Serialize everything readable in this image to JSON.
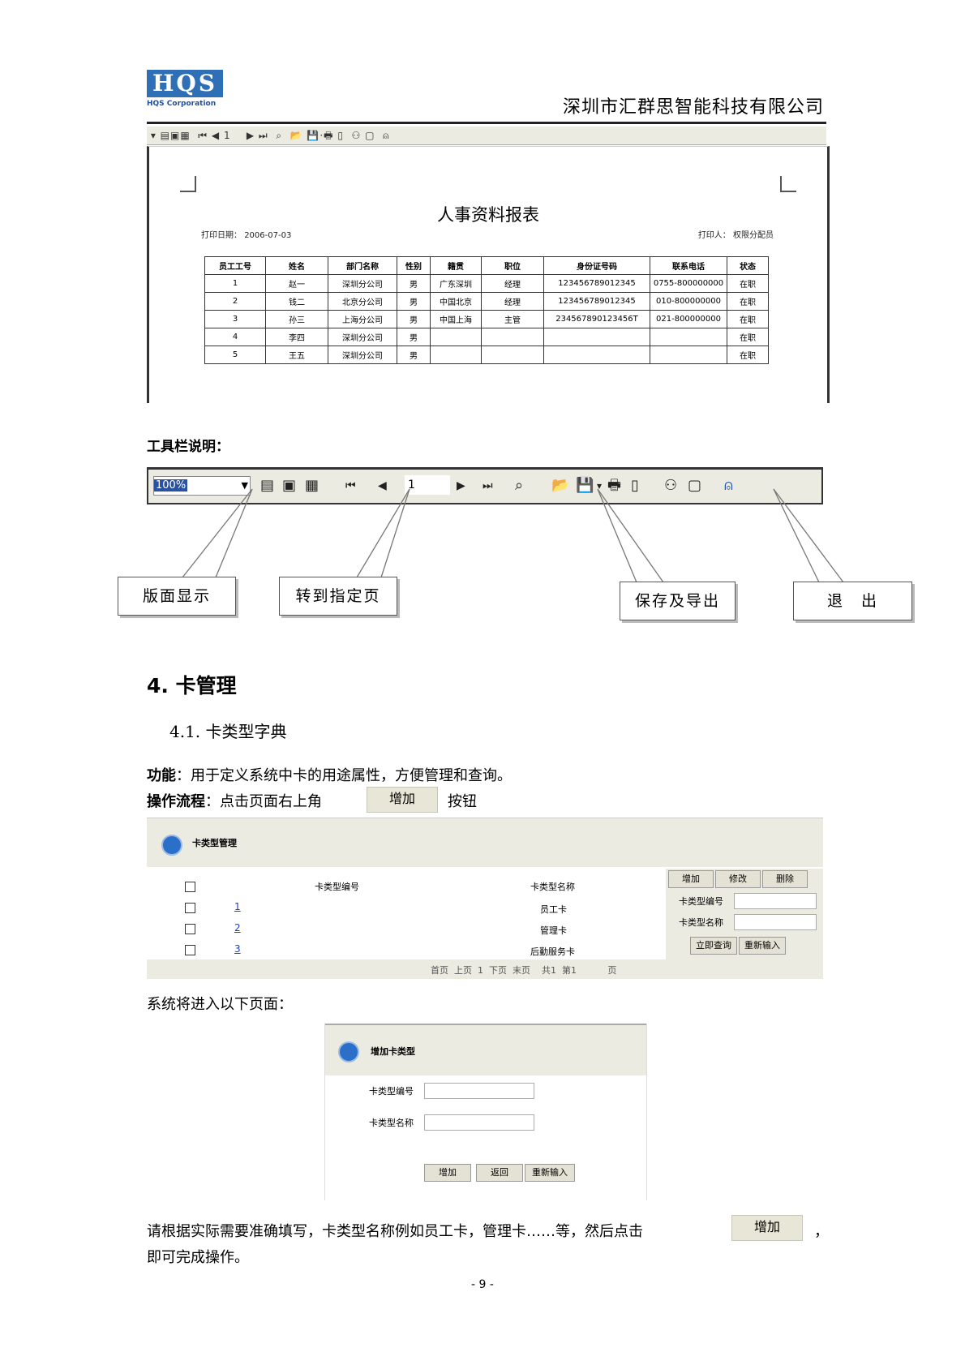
{
  "header": {
    "logo": "HQS",
    "logo_sub": "HQS Corporation",
    "company": "深圳市汇群思智能科技有限公司"
  },
  "toolbar_small": {
    "page": "1"
  },
  "report": {
    "title": "人事资料报表",
    "print_date_label": "打印日期：",
    "print_date": "2006-07-03",
    "printer_label": "打印人：",
    "printer": "权限分配员",
    "columns": [
      "员工工号",
      "姓名",
      "部门名称",
      "性别",
      "籍贯",
      "职位",
      "身份证号码",
      "联系电话",
      "状态"
    ],
    "rows": [
      [
        "1",
        "赵一",
        "深圳分公司",
        "男",
        "广东深圳",
        "经理",
        "123456789012345",
        "0755-800000000",
        "在职"
      ],
      [
        "2",
        "钱二",
        "北京分公司",
        "男",
        "中国北京",
        "经理",
        "123456789012345",
        "010-800000000",
        "在职"
      ],
      [
        "3",
        "孙三",
        "上海分公司",
        "男",
        "中国上海",
        "主管",
        "234567890123456T",
        "021-800000000",
        "在职"
      ],
      [
        "4",
        "李四",
        "深圳分公司",
        "男",
        "",
        "",
        "",
        "",
        "在职"
      ],
      [
        "5",
        "王五",
        "深圳分公司",
        "男",
        "",
        "",
        "",
        "",
        "在职"
      ]
    ]
  },
  "toolbar_section": {
    "heading": "工具栏说明：",
    "zoom": "100%",
    "page": "1"
  },
  "callouts": {
    "layout": "版面显示",
    "goto": "转到指定页",
    "save": "保存及导出",
    "exit": "退　出"
  },
  "section4": {
    "heading": "4.  卡管理",
    "sub": "4.1.  卡类型字典"
  },
  "desc": {
    "func_label": "功能",
    "func_text": "：用于定义系统中卡的用途属性，方便管理和查询。",
    "flow_label": "操作流程",
    "flow_text": "：点击页面右上角",
    "add_btn": "增加",
    "flow_tail": "按钮"
  },
  "card_mgmt": {
    "title": "卡类型管理",
    "col_code": "卡类型编号",
    "col_name": "卡类型名称",
    "rows": [
      [
        "1",
        "员工卡"
      ],
      [
        "2",
        "管理卡"
      ],
      [
        "3",
        "后勤服务卡"
      ]
    ],
    "btn_add": "增加",
    "btn_edit": "修改",
    "btn_del": "删除",
    "label_code": "卡类型编号",
    "label_name": "卡类型名称",
    "btn_query": "立即查询",
    "btn_reset": "重新输入",
    "pager": "首页  上页  1  下页  末页    共1  第1           页"
  },
  "next_text": "系统将进入以下页面：",
  "add_dialog": {
    "title": "增加卡类型",
    "label_code": "卡类型编号",
    "label_name": "卡类型名称",
    "btn_add": "增加",
    "btn_back": "返回",
    "btn_reset": "重新输入"
  },
  "final": {
    "line1": "请根据实际需要准确填写，卡类型名称例如员工卡，管理卡……等，然后点击",
    "btn": "增加",
    "comma": "，",
    "line2": "即可完成操作。"
  },
  "page_number": "- 9 -"
}
